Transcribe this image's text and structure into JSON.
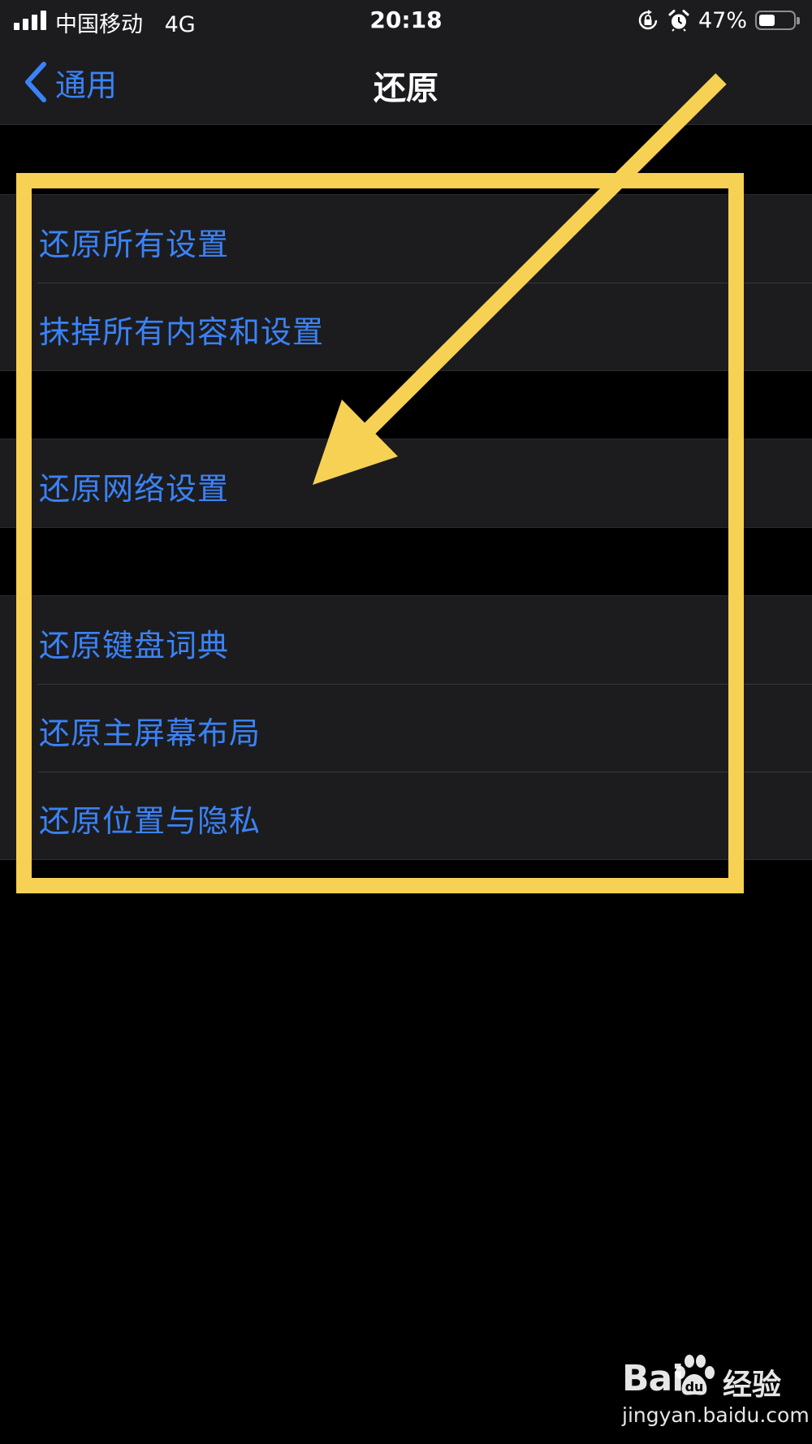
{
  "status_bar": {
    "carrier": "中国移动",
    "network": "4G",
    "time": "20:18",
    "battery_percent": "47%",
    "battery_level": 0.47
  },
  "nav": {
    "back_label": "通用",
    "title": "还原"
  },
  "groups": [
    {
      "items": [
        {
          "label": "还原所有设置"
        },
        {
          "label": "抹掉所有内容和设置"
        }
      ]
    },
    {
      "items": [
        {
          "label": "还原网络设置"
        }
      ]
    },
    {
      "items": [
        {
          "label": "还原键盘词典"
        },
        {
          "label": "还原主屏幕布局"
        },
        {
          "label": "还原位置与隐私"
        }
      ]
    }
  ],
  "watermark": {
    "brand_prefix": "Bai",
    "brand_suffix": "经验",
    "url": "jingyan.baidu.com"
  },
  "colors": {
    "accent": "#3b82f6",
    "annotation": "#f7d154",
    "background": "#000000",
    "cell_background": "#1c1c1e"
  }
}
